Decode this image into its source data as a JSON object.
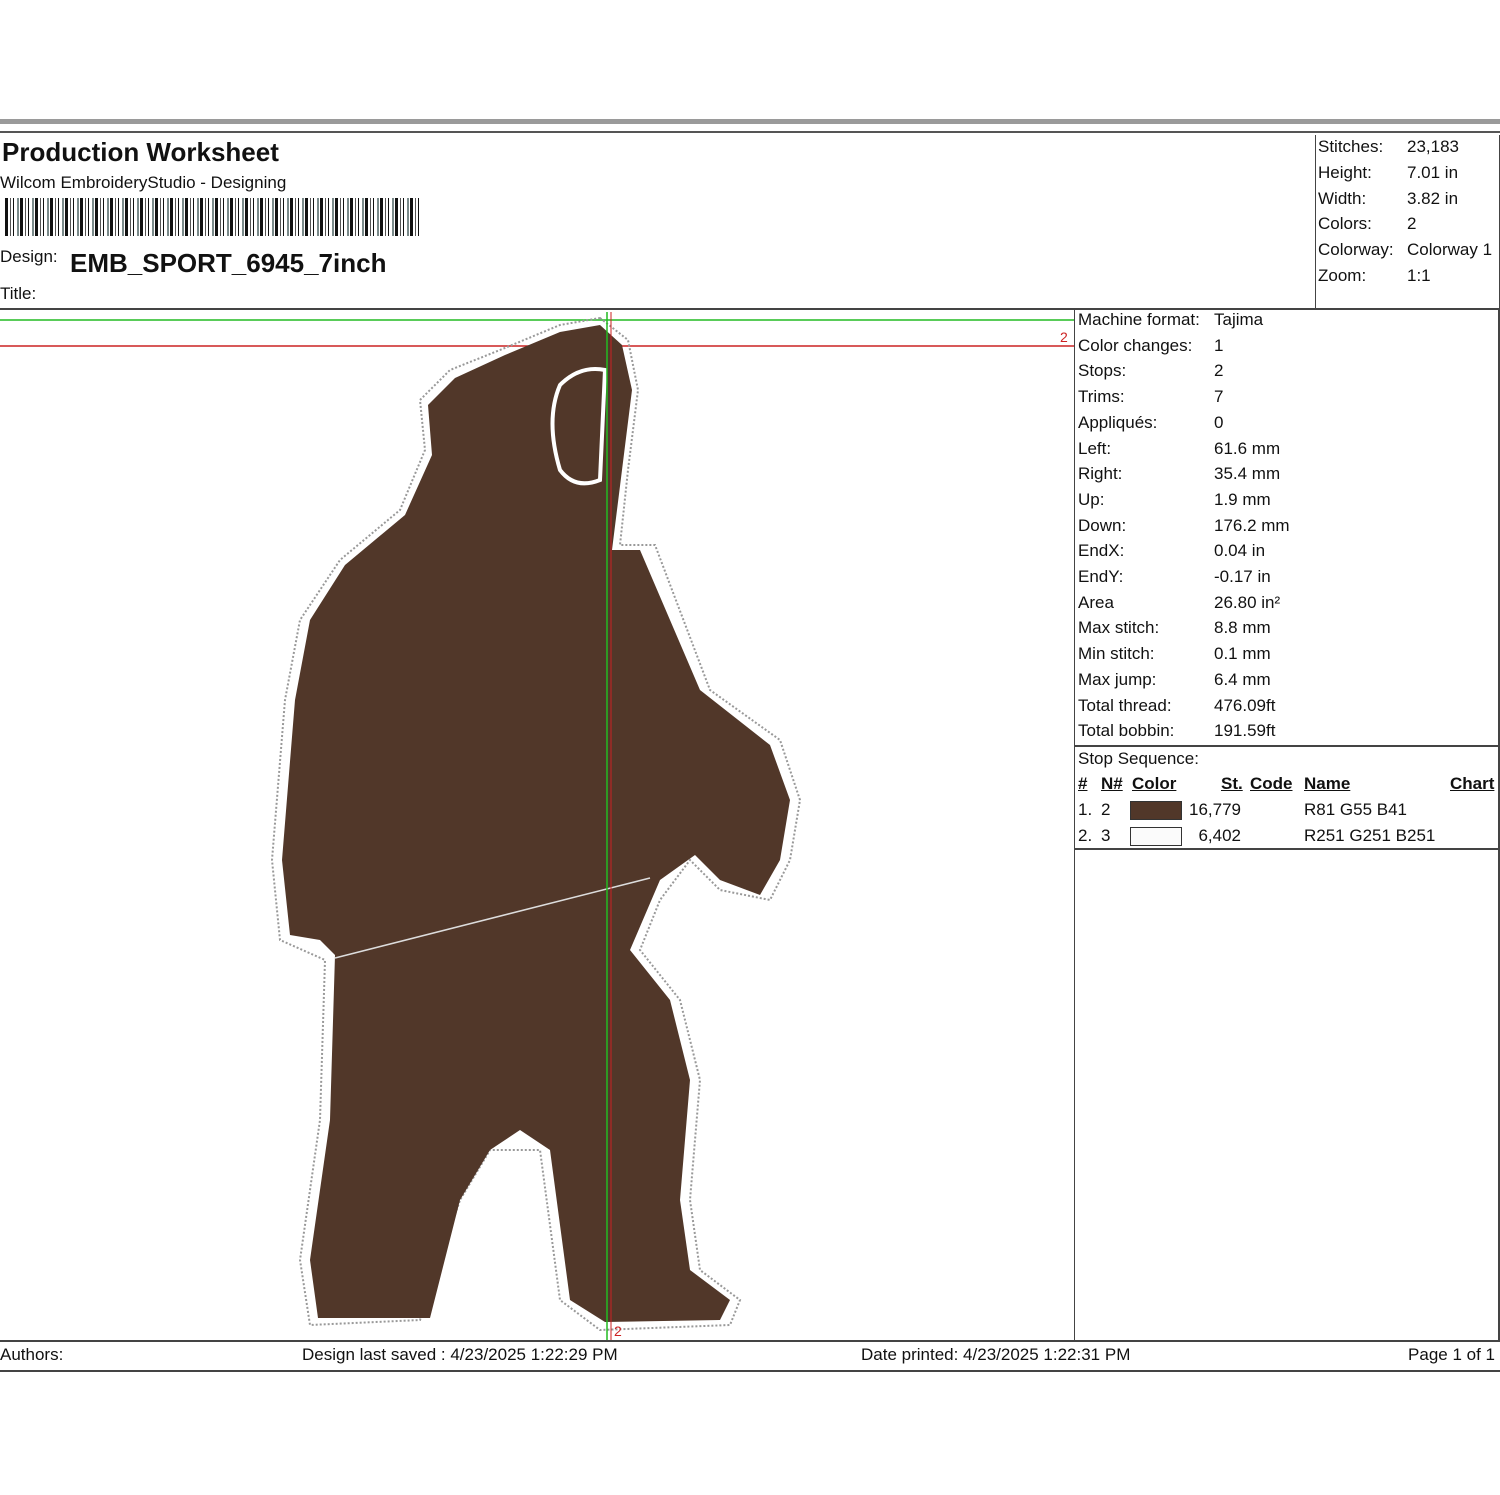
{
  "header": {
    "title": "Production Worksheet",
    "subtitle": "Wilcom EmbroideryStudio - Designing",
    "design_label": "Design:",
    "design_name": "EMB_SPORT_6945_7inch",
    "title_label": "Title:"
  },
  "summary": [
    {
      "label": "Stitches:",
      "value": "23,183"
    },
    {
      "label": "Height:",
      "value": "7.01 in"
    },
    {
      "label": "Width:",
      "value": "3.82 in"
    },
    {
      "label": "Colors:",
      "value": "2"
    },
    {
      "label": "Colorway:",
      "value": "Colorway 1"
    },
    {
      "label": "Zoom:",
      "value": "1:1"
    }
  ],
  "details": [
    {
      "label": "Machine format:",
      "value": "Tajima"
    },
    {
      "label": "Color changes:",
      "value": "1"
    },
    {
      "label": "Stops:",
      "value": "2"
    },
    {
      "label": "Trims:",
      "value": "7"
    },
    {
      "label": "Appliqués:",
      "value": "0"
    },
    {
      "label": "Left:",
      "value": "61.6 mm"
    },
    {
      "label": "Right:",
      "value": "35.4 mm"
    },
    {
      "label": "Up:",
      "value": "1.9 mm"
    },
    {
      "label": "Down:",
      "value": "176.2 mm"
    },
    {
      "label": "EndX:",
      "value": "0.04 in"
    },
    {
      "label": "EndY:",
      "value": "-0.17 in"
    },
    {
      "label": "Area",
      "value": " 26.80 in²"
    },
    {
      "label": "Max stitch:",
      "value": "8.8 mm"
    },
    {
      "label": "Min stitch:",
      "value": "0.1 mm"
    },
    {
      "label": "Max jump:",
      "value": "6.4 mm"
    },
    {
      "label": "Total thread:",
      "value": "476.09ft"
    },
    {
      "label": "Total bobbin:",
      "value": "191.59ft"
    }
  ],
  "stop_sequence": {
    "title": "Stop Sequence:",
    "headers": {
      "num": "#",
      "n": "N#",
      "color": "Color",
      "st": "St.",
      "code": "Code",
      "name": "Name",
      "chart": "Chart"
    },
    "rows": [
      {
        "num": "1.",
        "n": "2",
        "color": "#513729",
        "stitches": "16,779",
        "name": "R81 G55 B41"
      },
      {
        "num": "2.",
        "n": "3",
        "color": "#fbfbfb",
        "stitches": "6,402",
        "name": "R251 G251 B251"
      }
    ]
  },
  "canvas": {
    "marker_top": "2",
    "marker_bottom": "2",
    "bear_color": "#513729",
    "guide_green": "#22bb22",
    "guide_red": "#cc2222"
  },
  "footer": {
    "authors": "Authors:",
    "saved": "Design last saved : 4/23/2025 1:22:29 PM",
    "printed": "Date printed: 4/23/2025 1:22:31 PM",
    "page": "Page 1 of 1"
  }
}
